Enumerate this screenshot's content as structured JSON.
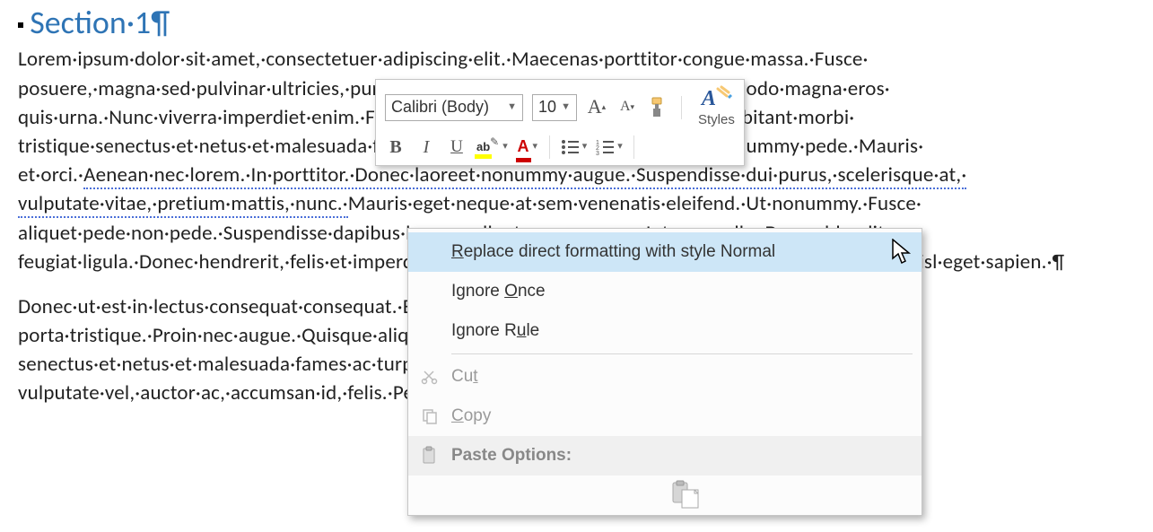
{
  "document": {
    "heading": "Section·1¶",
    "para1_before": "Lorem·ipsum·dolor·sit·amet,·consectetuer·adipiscing·elit.·Maecenas·porttitor·congue·massa.·Fusce· posuere,·magna·sed·pulvinar·ultricies,·purus·lectus·malesuada·libero,·sit·amet·commodo·magna·eros· quis·urna.·Nunc·viverra·imperdiet·enim.·Fusce·est.·Vivamus·a·tellus.·Pellentesque·habitant·morbi· tristique·senectus·et·netus·et·malesuada·fames·ac·turpis·egestas.·Proin·pharetra·nonummy·pede.·Mauris· et·orci.·",
    "squiggle_text": "Aenean·nec·lorem.·In·porttitor.·Donec·laoreet·nonummy·augue.·Suspendisse·dui·purus,·scelerisque·at,· vulputate·vitae,·pretium·mattis,·nunc.·",
    "para1_after": "Mauris·eget·neque·at·sem·venenatis·eleifend.·Ut·nonummy.·Fusce· aliquet·pede·non·pede.·Suspendisse·dapibus·lorem·pellentesque·magna.·Integer·nulla.·Donec·blandit· feugiat·ligula.·Donec·hendrerit,·felis·et·imperdiet·euismod,·purus·ipsum·pretium·metus,·in·lacinia·nulla· nisl·eget·sapien.·¶",
    "para2": "Donec·ut·est·in·lectus·consequat·consequat.·Etiam·eget·dui.·Aliquam·erat·volutpat.·Sed·at·lorem·in·nunc· porta·tristique.·Proin·nec·augue.·Quisque·aliquam·tempor·magna.·Pellentesque·habitant·morbi·tristique· senectus·et·netus·et·malesuada·fames·ac·turpis·egestas.·Nunc·ac·magna.·Maecenas·odio·dolor,· vulputate·vel,·auctor·ac,·accumsan·id,·felis.·Pellentesque·cursus·sagittis·felis.·Pellentesque·porttitor,·velit·"
  },
  "mini_toolbar": {
    "font_name": "Calibri (Body)",
    "font_size": "10",
    "styles_label": "Styles"
  },
  "context_menu": {
    "replace_pre": "R",
    "replace_post": "eplace direct formatting with style Normal",
    "ignore_once_pre": "Ignore ",
    "ignore_once_u": "O",
    "ignore_once_post": "nce",
    "ignore_rule_pre": "Ignore R",
    "ignore_rule_u": "u",
    "ignore_rule_post": "le",
    "cut_u": "t",
    "cut_pre": "Cu",
    "copy_u": "C",
    "copy_post": "opy",
    "paste_label": "Paste Options:"
  }
}
